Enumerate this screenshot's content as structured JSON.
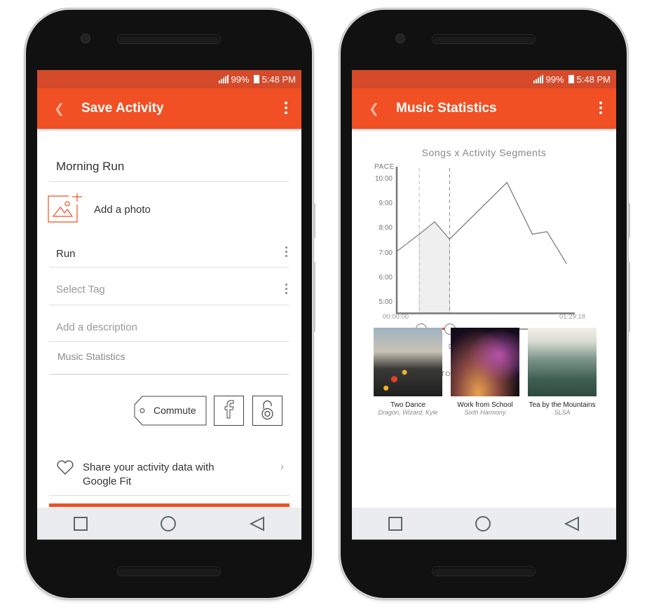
{
  "status_bar": {
    "battery": "99%",
    "time": "5:48 PM"
  },
  "colors": {
    "accent": "#f05023",
    "status_bar": "#d44a2a",
    "nav_bar": "#eaecef"
  },
  "save_activity": {
    "title": "Save Activity",
    "back_icon": "chevron-left-icon",
    "menu_icon": "more-vertical-icon",
    "activity_name": "Morning Run",
    "add_photo_label": "Add a photo",
    "activity_type": "Run",
    "tag_placeholder": "Select Tag",
    "description_placeholder": "Add a description",
    "music_statistics_link": "Music Statistics",
    "commute_label": "Commute",
    "facebook_icon": "facebook-icon",
    "privacy_icon": "unlock-icon",
    "google_fit_text": "Share your activity data with Google Fit",
    "google_fit_line1": "Share your activity data with",
    "google_fit_line2": "Google Fit"
  },
  "music_statistics": {
    "title": "Music Statistics",
    "back_icon": "chevron-left-icon",
    "menu_icon": "more-vertical-icon",
    "slider": {
      "start_label": "00:00:00",
      "end_label": "01:29:18",
      "selection_start_fraction": 0.13,
      "selection_end_fraction": 0.29,
      "caption": "DURATION OF RUN"
    },
    "songs_heading": "SONGS LISTENED TO:",
    "songs": [
      {
        "title": "Two Dance",
        "artist": "Dragon, Wizard, Kyle"
      },
      {
        "title": "Work from School",
        "artist": "Sixth Harmony"
      },
      {
        "title": "Tea by the Mountains",
        "artist": "SLSA"
      }
    ]
  },
  "chart_data": {
    "type": "line",
    "title": "Songs x Activity Segments",
    "ylabel": "PACE",
    "xlabel": "DURATION OF RUN",
    "y_ticks": [
      "5:00",
      "6:00",
      "7:00",
      "8:00",
      "9:00",
      "10:00"
    ],
    "ylim": [
      4.6,
      10.2
    ],
    "x_unit": "minutes",
    "xlim": [
      0,
      89.3
    ],
    "x_tick_labels": [
      "00:00:00",
      "01:29:18"
    ],
    "x": [
      0,
      11.3,
      19.0,
      26.5,
      55.3,
      68.0,
      75.4,
      85.2
    ],
    "values": [
      7.1,
      7.8,
      8.3,
      7.6,
      9.9,
      7.8,
      7.9,
      6.6
    ],
    "highlight_segment": {
      "x_start": 11.3,
      "x_end": 26.5,
      "label": "selected song segment"
    },
    "grid": false
  },
  "nav": {
    "recents": "square-icon",
    "home": "circle-icon",
    "back": "triangle-back-icon"
  }
}
